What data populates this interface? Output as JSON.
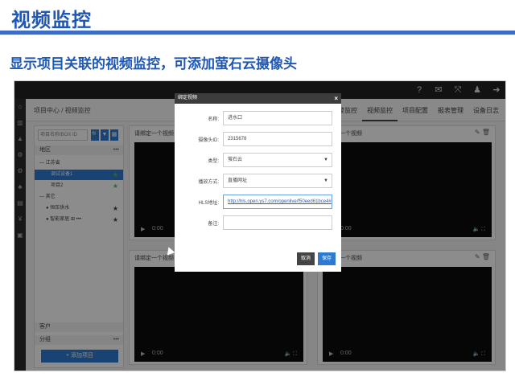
{
  "slide": {
    "title": "视频监控",
    "subtitle": "显示项目关联的视频监控，可添加萤石云摄像头"
  },
  "app": {
    "top_icons": [
      "?",
      "✉",
      "⤧",
      "♟",
      "➜"
    ],
    "left_nav_icons": [
      "⌂",
      "▥",
      "▲",
      "⚙",
      "⚙",
      "♣",
      "▤",
      "¥",
      "▣"
    ],
    "breadcrumb": "项目中心 / 视频监控",
    "tabs": [
      {
        "label": "报警监控",
        "active": false
      },
      {
        "label": "视频监控",
        "active": true
      },
      {
        "label": "项目配置",
        "active": false
      },
      {
        "label": "报表管理",
        "active": false
      },
      {
        "label": "设备日志",
        "active": false
      }
    ]
  },
  "sidebar": {
    "search_placeholder": "项目名称/BOX ID",
    "search_icon": "🔍",
    "filter_icon": "▼",
    "grid_icon": "▦",
    "region_header": "地区",
    "region_menu": "•••",
    "tree": [
      {
        "label": "江苏省",
        "prefix": "—"
      },
      {
        "label": "调试设备1",
        "prefix": "",
        "star": "★",
        "selected": true
      },
      {
        "label": "项目2",
        "prefix": "",
        "star": "★"
      },
      {
        "label": "其它",
        "prefix": "—"
      },
      {
        "label": "恒压供水",
        "prefix": "●",
        "star": "★"
      },
      {
        "label": "智能家居",
        "prefix": "●",
        "extra": "⊞ •••",
        "star": "★"
      }
    ],
    "client_header": "客户",
    "group_header": "分组",
    "group_menu": "•••",
    "add_button": "+ 添加项目"
  },
  "panels": [
    {
      "title": "请绑定一个视频",
      "time": "0:00"
    },
    {
      "title": "请绑定一个视频",
      "time": "0:00"
    },
    {
      "title": "请绑定一个视频",
      "time": "0:00"
    },
    {
      "title": "请绑定一个视频",
      "time": "0:00"
    }
  ],
  "panel_icons": "✎ 🗑",
  "video_icons": "🔈 ⛶",
  "modal": {
    "title": "绑定视频",
    "close": "×",
    "fields": [
      {
        "label": "名称:",
        "value": "进水口"
      },
      {
        "label": "摄像头ID:",
        "value": "2315678"
      },
      {
        "label": "类型:",
        "value": "萤石云",
        "select": true
      },
      {
        "label": "播放方式:",
        "value": "直播网址",
        "select": true
      },
      {
        "label": "HLS地址:",
        "value": "http://hls.open.ys7.com/openlive/f50eed61bce4#"
      },
      {
        "label": "备注:",
        "value": ""
      }
    ],
    "cancel": "取消",
    "save": "保存",
    "save_color": "#2d7bd1",
    "cancel_color": "#444444"
  }
}
